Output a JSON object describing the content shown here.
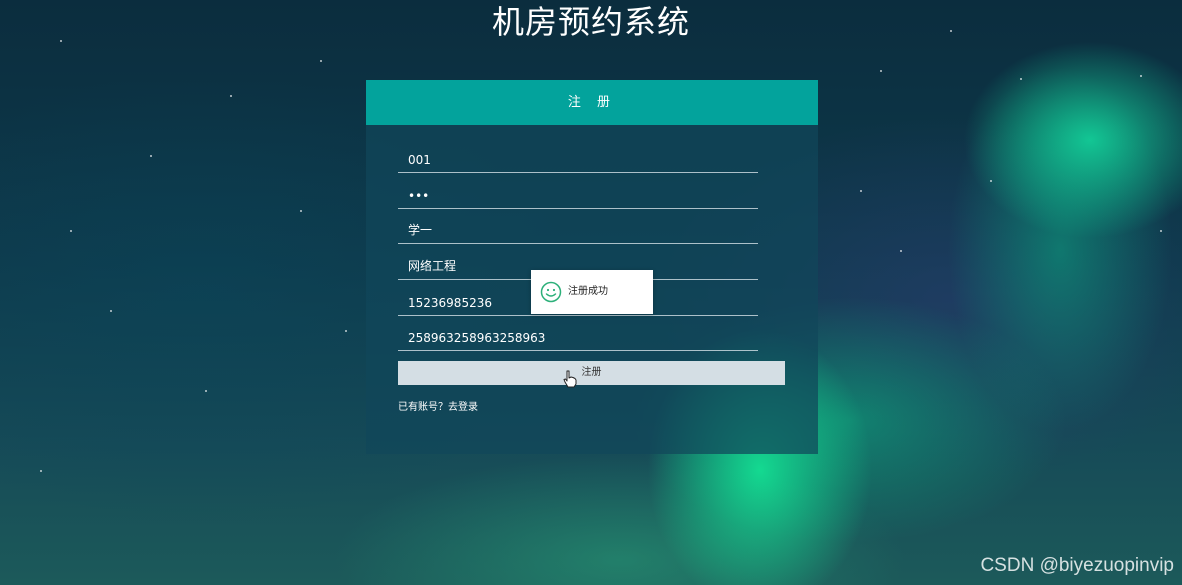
{
  "page": {
    "title": "机房预约系统"
  },
  "register_form": {
    "header": "注 册",
    "fields": [
      {
        "name": "account",
        "value": "001"
      },
      {
        "name": "password",
        "value": "•••"
      },
      {
        "name": "name",
        "value": "学一"
      },
      {
        "name": "major",
        "value": "网络工程"
      },
      {
        "name": "phone",
        "value": "15236985236"
      },
      {
        "name": "id_number",
        "value": "258963258963258963"
      }
    ],
    "submit_label": "注册",
    "login_link": "已有账号？去登录"
  },
  "toast": {
    "icon": "smile-icon",
    "message": "注册成功"
  },
  "watermark": "CSDN @biyezuopinvip",
  "colors": {
    "header": "#03a39c",
    "toast_icon": "#2db07a",
    "button": "#d4dee4"
  }
}
